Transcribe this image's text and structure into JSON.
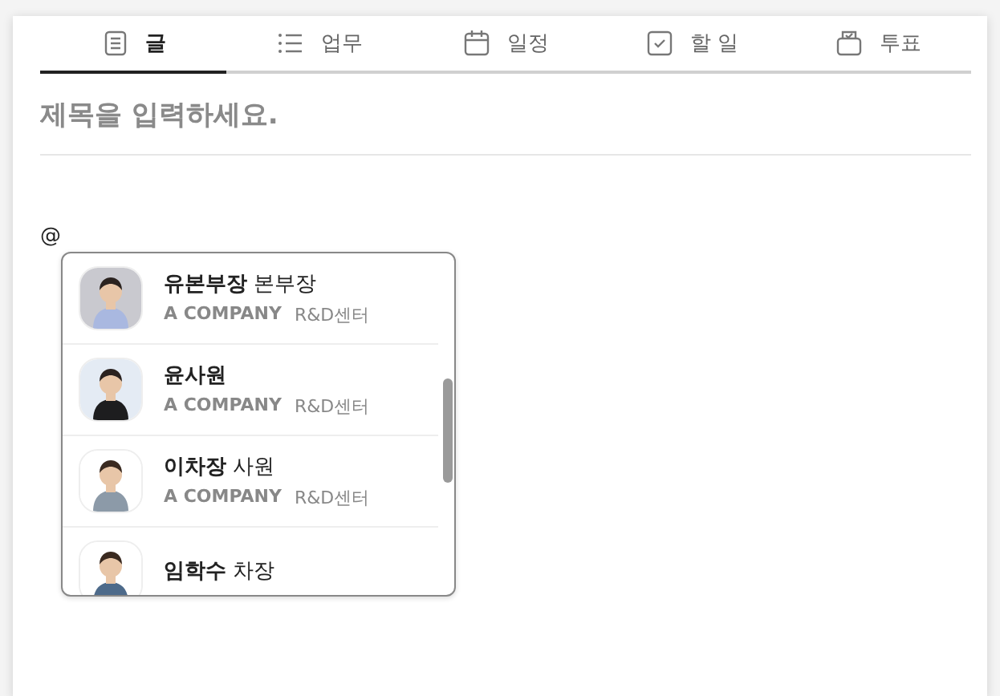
{
  "tabs": [
    {
      "label": "글",
      "kind": "document",
      "selected": true
    },
    {
      "label": "업무",
      "kind": "list",
      "selected": false
    },
    {
      "label": "일정",
      "kind": "calendar",
      "selected": false
    },
    {
      "label": "할 일",
      "kind": "checkbox",
      "selected": false
    },
    {
      "label": "투표",
      "kind": "ballot",
      "selected": false
    }
  ],
  "title_field": {
    "placeholder": "제목을 입력하세요."
  },
  "editor": {
    "value": "@"
  },
  "mention_list": [
    {
      "name": "유본부장",
      "position": "본부장",
      "company": "A COMPANY",
      "department": "R&D센터"
    },
    {
      "name": "윤사원",
      "company": "A COMPANY",
      "department": "R&D센터"
    },
    {
      "name": "이차장",
      "position": "사원",
      "company": "A COMPANY",
      "department": "R&D센터"
    },
    {
      "name": "임학수",
      "position": "차장"
    }
  ]
}
